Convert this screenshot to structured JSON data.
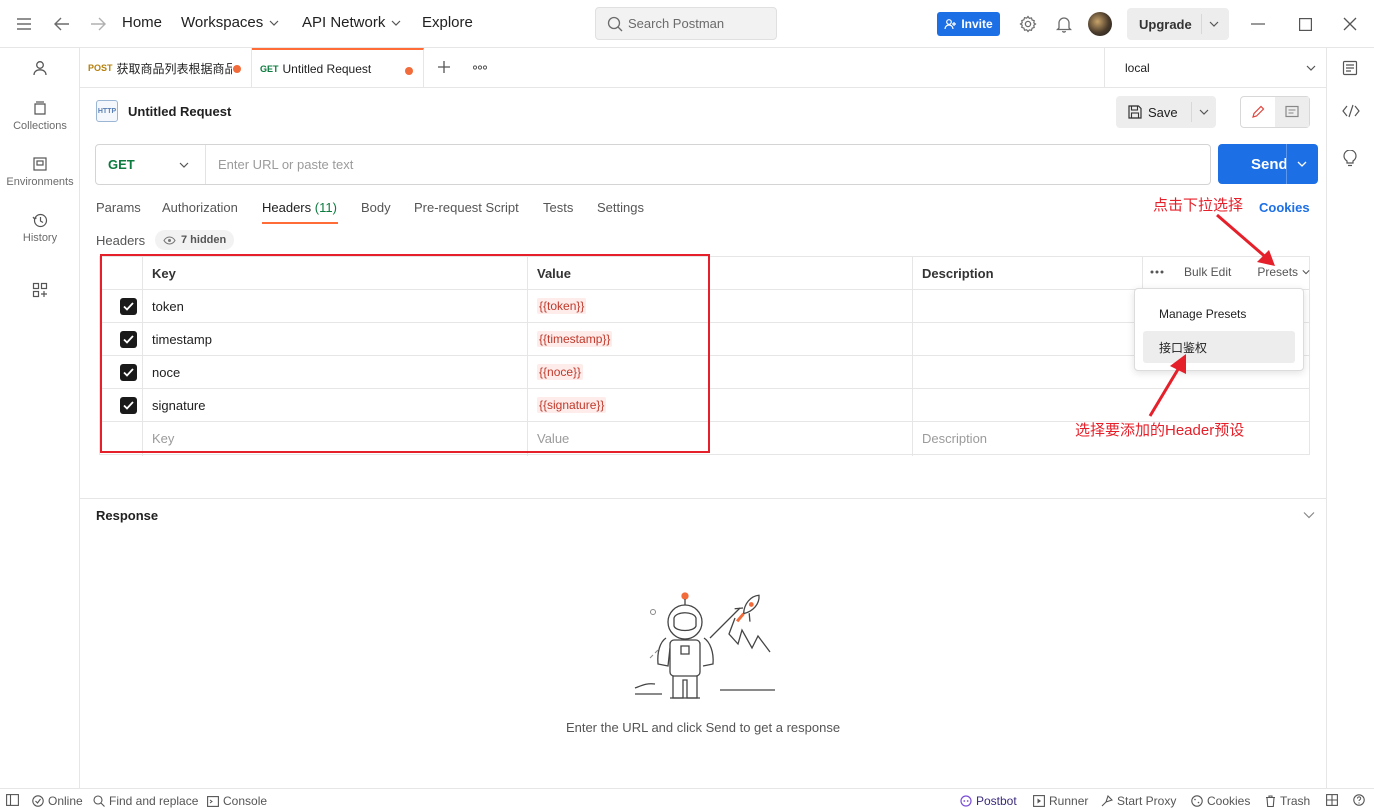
{
  "topbar": {
    "nav": [
      "Home",
      "Workspaces",
      "API Network",
      "Explore"
    ],
    "search_placeholder": "Search Postman",
    "invite": "Invite",
    "upgrade": "Upgrade"
  },
  "sidebar": {
    "items": [
      {
        "label": "Collections",
        "icon": "collections-icon"
      },
      {
        "label": "Environments",
        "icon": "environments-icon"
      },
      {
        "label": "History",
        "icon": "history-icon"
      }
    ]
  },
  "tabs": [
    {
      "method": "POST",
      "label": "获取商品列表根据商品",
      "method_color": "#b5800c",
      "unsaved": true
    },
    {
      "method": "GET",
      "label": "Untitled Request",
      "method_color": "#0b7b3e",
      "unsaved": true,
      "active": true
    }
  ],
  "environment": "local",
  "request": {
    "title": "Untitled Request",
    "http_badge": "HTTP",
    "save": "Save",
    "method": "GET",
    "url_placeholder": "Enter URL or paste text",
    "send": "Send"
  },
  "request_tabs": {
    "params": "Params",
    "authorization": "Authorization",
    "headers": "Headers",
    "headers_count": "(11)",
    "body": "Body",
    "prerequest": "Pre-request Script",
    "tests": "Tests",
    "settings": "Settings",
    "cookies": "Cookies"
  },
  "headers_section": {
    "label": "Headers",
    "hidden": "7 hidden",
    "columns": {
      "key": "Key",
      "value": "Value",
      "description": "Description"
    },
    "bulk_edit": "Bulk Edit",
    "presets": "Presets",
    "rows": [
      {
        "key": "token",
        "value": "{{token}}"
      },
      {
        "key": "timestamp",
        "value": "{{timestamp}}"
      },
      {
        "key": "noce",
        "value": "{{noce}}"
      },
      {
        "key": "signature",
        "value": "{{signature}}"
      }
    ],
    "placeholder": {
      "key": "Key",
      "value": "Value",
      "description": "Description"
    }
  },
  "presets_menu": {
    "manage": "Manage Presets",
    "item": "接口鉴权"
  },
  "annotations": {
    "click_dropdown": "点击下拉选择",
    "select_preset": "选择要添加的Header预设"
  },
  "response": {
    "title": "Response",
    "empty": "Enter the URL and click Send to get a response"
  },
  "statusbar": {
    "online": "Online",
    "find_replace": "Find and replace",
    "console": "Console",
    "postbot": "Postbot",
    "runner": "Runner",
    "start_proxy": "Start Proxy",
    "cookies": "Cookies",
    "trash": "Trash"
  },
  "colors": {
    "accent": "#ff6c37",
    "primary": "#1d6fe6",
    "get": "#0b7b3e",
    "annotation": "#e5202a"
  }
}
